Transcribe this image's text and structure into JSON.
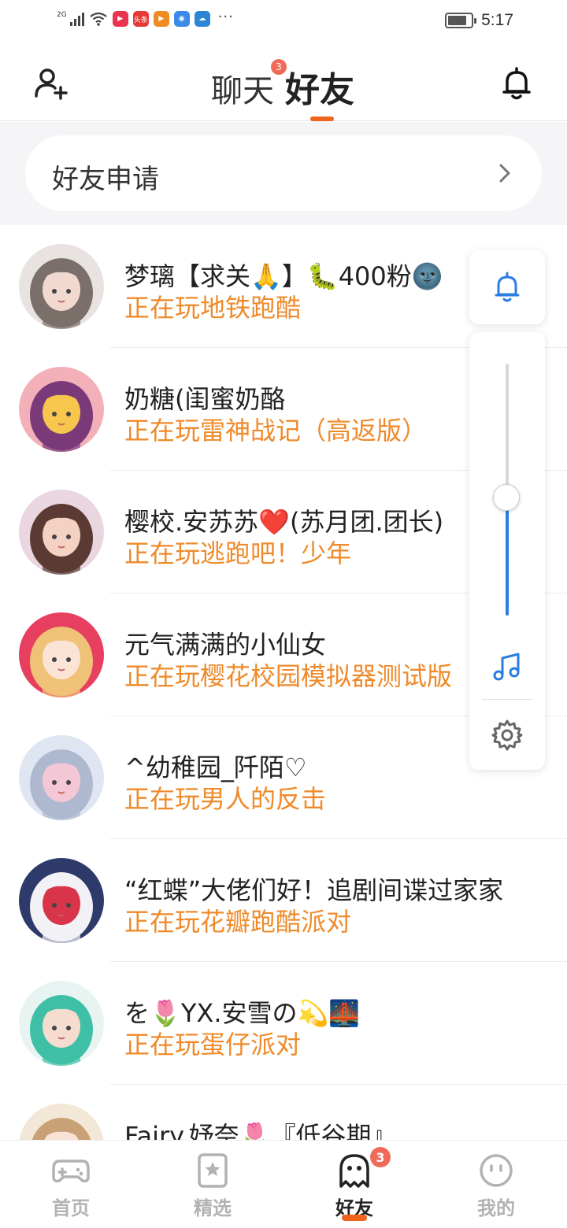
{
  "status_bar": {
    "network": "2G",
    "app_icons": [
      {
        "name": "video-app-icon",
        "color": "#e8344e",
        "glyph": "▶"
      },
      {
        "name": "news-app-icon",
        "color": "#e53935",
        "glyph": "头条"
      },
      {
        "name": "play-app-icon",
        "color": "#f08a24",
        "glyph": "▶"
      },
      {
        "name": "browser-app-icon",
        "color": "#3b8be8",
        "glyph": "◉"
      },
      {
        "name": "cloud-app-icon",
        "color": "#2b86d6",
        "glyph": "☁"
      }
    ],
    "more": "···",
    "battery_level": 0.8,
    "time": "5:17"
  },
  "header": {
    "tab_chat": "聊天",
    "tab_chat_badge": "3",
    "tab_friends": "好友"
  },
  "friend_request": {
    "label": "好友申请"
  },
  "friends": [
    {
      "name": "梦璃【求关🙏】🐛400粉🌚",
      "status": "正在玩地铁跑酷",
      "avatar_colors": [
        "#e8e3e0",
        "#7a6f6a",
        "#f2d9cf"
      ]
    },
    {
      "name": "奶糖(闺蜜奶酪",
      "status": "正在玩雷神战记（高返版）",
      "avatar_colors": [
        "#f3b0b8",
        "#7a3a7a",
        "#f6c64d"
      ]
    },
    {
      "name": "樱校.安苏苏❤️(苏月团.团长)",
      "status": "正在玩逃跑吧！少年",
      "avatar_colors": [
        "#e9d6e0",
        "#5a3a32",
        "#f3d2c4"
      ]
    },
    {
      "name": "元气满满的小仙女",
      "status": "正在玩樱花校园模拟器测试版",
      "avatar_colors": [
        "#e63f5f",
        "#f0c277",
        "#fbe3d6"
      ]
    },
    {
      "name": "^幼稚园_阡陌♡",
      "status": "正在玩男人的反击",
      "avatar_colors": [
        "#dfe6f2",
        "#aeb8cf",
        "#f4c7d6"
      ]
    },
    {
      "name": "“红蝶”大佬们好！追剧间谍过家家",
      "status": "正在玩花瓣跑酷派对",
      "avatar_colors": [
        "#2d3a6a",
        "#f2f2f6",
        "#d8344a"
      ]
    },
    {
      "name": "を🌷YX.安雪の💫🌉",
      "status": "正在玩蛋仔派对",
      "avatar_colors": [
        "#e8f4f2",
        "#3fbfa6",
        "#f6dccf"
      ]
    },
    {
      "name": "Fairy.妤奈🌷『低谷期』",
      "status": "",
      "avatar_colors": [
        "#f3e7d8",
        "#c8a276",
        "#f8e3d5"
      ]
    }
  ],
  "floating_panel": {
    "volume_level": 0.47,
    "accent": "#2a7de1"
  },
  "bottom_nav": [
    {
      "label": "首页",
      "icon": "gamepad-icon",
      "active": false
    },
    {
      "label": "精选",
      "icon": "star-bookmark-icon",
      "active": false
    },
    {
      "label": "好友",
      "icon": "ghost-friends-icon",
      "active": true,
      "badge": "3"
    },
    {
      "label": "我的",
      "icon": "face-icon",
      "active": false
    }
  ],
  "colors": {
    "accent_orange": "#f0641e",
    "status_orange": "#ef8a2a",
    "badge_red": "#f06a5a"
  }
}
